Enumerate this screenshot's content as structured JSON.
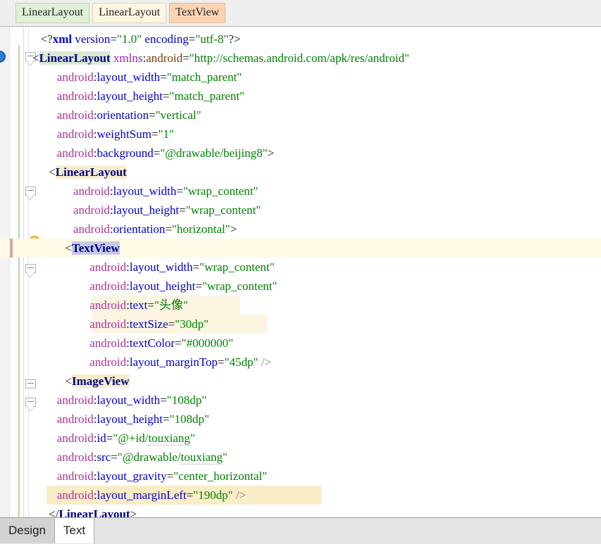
{
  "window": {
    "editor_type": "android-xml-layout-editor"
  },
  "breadcrumb": {
    "name": "component-breadcrumb",
    "chips": [
      {
        "label": "LinearLayout",
        "color": "#dff0d8",
        "state": "root"
      },
      {
        "label": "LinearLayout",
        "color": "#fdf6e0",
        "state": "parent"
      },
      {
        "label": "TextView",
        "color": "#fbd3b4",
        "state": "selected"
      }
    ]
  },
  "gutter": {
    "icons": [
      {
        "name": "breakpoint-circle-icon",
        "type": "circle",
        "color": "#2d7fd6"
      },
      {
        "name": "intention-lightbulb-icon",
        "type": "lightbulb",
        "color": "#f5b428"
      }
    ],
    "fold_markers": [
      "collapse-1",
      "collapse-2",
      "collapse-3",
      "collapse-4"
    ]
  },
  "colors": {
    "tag": "#000080",
    "attribute": "#0000cc",
    "namespace": "#9c27b0",
    "string": "#008000",
    "punctuation": "#222222",
    "current_line_bg": "#fffae6",
    "cream_highlight_bg": "#fbf5e2",
    "tan_highlight_bg": "#f9edc8",
    "selection_bg": "#c5cbe8",
    "tag_match_bg": "#d9ead3"
  },
  "code": {
    "file_type": "xml",
    "lines": [
      {
        "id": "line-1",
        "indent": 1,
        "row_highlight": "none",
        "tokens": [
          {
            "t": "<?",
            "c": "punct"
          },
          {
            "t": "xml",
            "c": "xmlkw"
          },
          {
            "t": " ",
            "c": "punct"
          },
          {
            "t": "version",
            "c": "decl"
          },
          {
            "t": "=",
            "c": "punct"
          },
          {
            "t": "\"1.0\"",
            "c": "string"
          },
          {
            "t": " ",
            "c": "punct"
          },
          {
            "t": "encoding",
            "c": "decl"
          },
          {
            "t": "=",
            "c": "punct"
          },
          {
            "t": "\"utf-8\"",
            "c": "string"
          },
          {
            "t": "?>",
            "c": "punct"
          }
        ]
      },
      {
        "id": "line-2",
        "indent": 0,
        "row_highlight": "none",
        "tokens": [
          {
            "t": "<",
            "c": "punct"
          },
          {
            "t": "LinearLayout",
            "c": "tag",
            "bg": "tagmatch"
          },
          {
            "t": " ",
            "c": "punct"
          },
          {
            "t": "xmlns",
            "c": "ns"
          },
          {
            "t": ":",
            "c": "punct"
          },
          {
            "t": "android",
            "c": "ns-dark"
          },
          {
            "t": "=",
            "c": "punct"
          },
          {
            "t": "\"http://schemas.android.com/apk/res/android\"",
            "c": "string"
          }
        ]
      },
      {
        "id": "line-3",
        "indent": 3,
        "row_highlight": "none",
        "tokens": [
          {
            "t": "android",
            "c": "prefix"
          },
          {
            "t": ":",
            "c": "punct"
          },
          {
            "t": "layout_width",
            "c": "attr"
          },
          {
            "t": "=",
            "c": "punct"
          },
          {
            "t": "\"match_parent\"",
            "c": "string"
          }
        ]
      },
      {
        "id": "line-4",
        "indent": 3,
        "row_highlight": "none",
        "tokens": [
          {
            "t": "android",
            "c": "prefix"
          },
          {
            "t": ":",
            "c": "punct"
          },
          {
            "t": "layout_height",
            "c": "attr"
          },
          {
            "t": "=",
            "c": "punct"
          },
          {
            "t": "\"match_parent\"",
            "c": "string"
          }
        ]
      },
      {
        "id": "line-5",
        "indent": 3,
        "row_highlight": "none",
        "tokens": [
          {
            "t": "android",
            "c": "prefix"
          },
          {
            "t": ":",
            "c": "punct"
          },
          {
            "t": "orientation",
            "c": "attr"
          },
          {
            "t": "=",
            "c": "punct"
          },
          {
            "t": "\"vertical\"",
            "c": "string"
          }
        ]
      },
      {
        "id": "line-6",
        "indent": 3,
        "row_highlight": "none",
        "tokens": [
          {
            "t": "android",
            "c": "prefix"
          },
          {
            "t": ":",
            "c": "punct"
          },
          {
            "t": "weightSum",
            "c": "attr"
          },
          {
            "t": "=",
            "c": "punct"
          },
          {
            "t": "\"1\"",
            "c": "string"
          }
        ]
      },
      {
        "id": "line-7",
        "indent": 3,
        "row_highlight": "none",
        "tokens": [
          {
            "t": "android",
            "c": "prefix"
          },
          {
            "t": ":",
            "c": "punct"
          },
          {
            "t": "background",
            "c": "attr"
          },
          {
            "t": "=",
            "c": "punct"
          },
          {
            "t": "\"@drawable/beijing8\"",
            "c": "string"
          },
          {
            "t": ">",
            "c": "punct"
          }
        ]
      },
      {
        "id": "line-8",
        "indent": 2,
        "row_highlight": "none",
        "tokens": [
          {
            "t": "<",
            "c": "punct"
          },
          {
            "t": "LinearLayout",
            "c": "tag",
            "bg": "token"
          }
        ]
      },
      {
        "id": "line-9",
        "indent": 5,
        "row_highlight": "none",
        "tokens": [
          {
            "t": "android",
            "c": "prefix"
          },
          {
            "t": ":",
            "c": "punct"
          },
          {
            "t": "layout_width",
            "c": "attr"
          },
          {
            "t": "=",
            "c": "punct"
          },
          {
            "t": "\"wrap_content\"",
            "c": "string"
          }
        ]
      },
      {
        "id": "line-10",
        "indent": 5,
        "row_highlight": "none",
        "tokens": [
          {
            "t": "android",
            "c": "prefix"
          },
          {
            "t": ":",
            "c": "punct"
          },
          {
            "t": "layout_height",
            "c": "attr"
          },
          {
            "t": "=",
            "c": "punct"
          },
          {
            "t": "\"wrap_content\"",
            "c": "string"
          }
        ]
      },
      {
        "id": "line-11",
        "indent": 5,
        "row_highlight": "none",
        "tokens": [
          {
            "t": "android",
            "c": "prefix"
          },
          {
            "t": ":",
            "c": "punct"
          },
          {
            "t": "orientation",
            "c": "attr"
          },
          {
            "t": "=",
            "c": "punct"
          },
          {
            "t": "\"horizontal\"",
            "c": "string"
          },
          {
            "t": ">",
            "c": "punct"
          }
        ]
      },
      {
        "id": "line-12",
        "indent": 4,
        "row_highlight": "current",
        "change_bar": true,
        "tokens": [
          {
            "t": "<",
            "c": "punct"
          },
          {
            "t": "TextView",
            "c": "tag",
            "bg": "sel"
          }
        ]
      },
      {
        "id": "line-13",
        "indent": 7,
        "row_highlight": "none",
        "tokens": [
          {
            "t": "android",
            "c": "prefix"
          },
          {
            "t": ":",
            "c": "punct"
          },
          {
            "t": "layout_width",
            "c": "attr"
          },
          {
            "t": "=",
            "c": "punct"
          },
          {
            "t": "\"wrap_content\"",
            "c": "string"
          }
        ]
      },
      {
        "id": "line-14",
        "indent": 7,
        "row_highlight": "none",
        "tokens": [
          {
            "t": "android",
            "c": "prefix"
          },
          {
            "t": ":",
            "c": "punct"
          },
          {
            "t": "layout_height",
            "c": "attr"
          },
          {
            "t": "=",
            "c": "punct"
          },
          {
            "t": "\"wrap_content\"",
            "c": "string"
          }
        ]
      },
      {
        "id": "line-15",
        "indent": 7,
        "row_highlight": "cream",
        "hl_start": 130,
        "hl_width": 210,
        "tokens": [
          {
            "t": "android",
            "c": "prefix"
          },
          {
            "t": ":",
            "c": "punct"
          },
          {
            "t": "text",
            "c": "attr"
          },
          {
            "t": "=",
            "c": "punct"
          },
          {
            "t": "\"头像\"",
            "c": "string"
          }
        ]
      },
      {
        "id": "line-16",
        "indent": 7,
        "row_highlight": "cream",
        "hl_start": 130,
        "hl_width": 250,
        "tokens": [
          {
            "t": "android",
            "c": "prefix"
          },
          {
            "t": ":",
            "c": "punct"
          },
          {
            "t": "textSize",
            "c": "attr"
          },
          {
            "t": "=",
            "c": "punct"
          },
          {
            "t": "\"30dp\"",
            "c": "string"
          }
        ]
      },
      {
        "id": "line-17",
        "indent": 7,
        "row_highlight": "none",
        "tokens": [
          {
            "t": "android",
            "c": "prefix"
          },
          {
            "t": ":",
            "c": "punct"
          },
          {
            "t": "textColor",
            "c": "attr"
          },
          {
            "t": "=",
            "c": "punct"
          },
          {
            "t": "\"#000000\"",
            "c": "string"
          }
        ]
      },
      {
        "id": "line-18",
        "indent": 7,
        "row_highlight": "none",
        "tokens": [
          {
            "t": "android",
            "c": "prefix"
          },
          {
            "t": ":",
            "c": "punct"
          },
          {
            "t": "layout_marginTop",
            "c": "attr"
          },
          {
            "t": "=",
            "c": "punct"
          },
          {
            "t": "\"45dp\"",
            "c": "string"
          },
          {
            "t": " ",
            "c": "punct"
          },
          {
            "t": "/>",
            "c": "gray"
          }
        ]
      },
      {
        "id": "line-19",
        "indent": 4,
        "row_highlight": "none",
        "tokens": [
          {
            "t": "<",
            "c": "punct"
          },
          {
            "t": "ImageView",
            "c": "tag",
            "bg": "token"
          }
        ]
      },
      {
        "id": "line-20",
        "indent": 3,
        "row_highlight": "none",
        "tokens": [
          {
            "t": "android",
            "c": "prefix"
          },
          {
            "t": ":",
            "c": "punct"
          },
          {
            "t": "layout_width",
            "c": "attr"
          },
          {
            "t": "=",
            "c": "punct"
          },
          {
            "t": "\"108dp\"",
            "c": "string"
          }
        ]
      },
      {
        "id": "line-21",
        "indent": 3,
        "row_highlight": "none",
        "tokens": [
          {
            "t": "android",
            "c": "prefix"
          },
          {
            "t": ":",
            "c": "punct"
          },
          {
            "t": "layout_height",
            "c": "attr"
          },
          {
            "t": "=",
            "c": "punct"
          },
          {
            "t": "\"108dp\"",
            "c": "string"
          }
        ]
      },
      {
        "id": "line-22",
        "indent": 3,
        "row_highlight": "none",
        "tokens": [
          {
            "t": "android",
            "c": "prefix"
          },
          {
            "t": ":",
            "c": "punct"
          },
          {
            "t": "id",
            "c": "attr"
          },
          {
            "t": "=",
            "c": "punct"
          },
          {
            "t": "\"@+id/",
            "c": "string"
          },
          {
            "t": "touxiang",
            "c": "unres"
          },
          {
            "t": "\"",
            "c": "string"
          }
        ]
      },
      {
        "id": "line-23",
        "indent": 3,
        "row_highlight": "none",
        "tokens": [
          {
            "t": "android",
            "c": "prefix"
          },
          {
            "t": ":",
            "c": "punct"
          },
          {
            "t": "src",
            "c": "attr"
          },
          {
            "t": "=",
            "c": "punct"
          },
          {
            "t": "\"@drawable/",
            "c": "string"
          },
          {
            "t": "touxiang",
            "c": "unres"
          },
          {
            "t": "\"",
            "c": "string"
          }
        ]
      },
      {
        "id": "line-24",
        "indent": 3,
        "row_highlight": "none",
        "tokens": [
          {
            "t": "android",
            "c": "prefix"
          },
          {
            "t": ":",
            "c": "punct"
          },
          {
            "t": "layout_gravity",
            "c": "attr"
          },
          {
            "t": "=",
            "c": "punct"
          },
          {
            "t": "\"center_horizontal\"",
            "c": "string"
          }
        ]
      },
      {
        "id": "line-25",
        "indent": 3,
        "row_highlight": "tan",
        "hl_start": 66,
        "hl_width": 390,
        "tokens": [
          {
            "t": "android",
            "c": "prefix"
          },
          {
            "t": ":",
            "c": "punct"
          },
          {
            "t": "layout_marginLeft",
            "c": "attr"
          },
          {
            "t": "=",
            "c": "punct"
          },
          {
            "t": "\"190dp\"",
            "c": "string"
          },
          {
            "t": " ",
            "c": "punct"
          },
          {
            "t": "/>",
            "c": "gray"
          }
        ]
      },
      {
        "id": "line-26",
        "indent": 2,
        "row_highlight": "none",
        "tokens": [
          {
            "t": "</",
            "c": "punct"
          },
          {
            "t": "LinearLayout",
            "c": "tag"
          },
          {
            "t": ">",
            "c": "punct"
          }
        ]
      }
    ]
  },
  "bottom_tabs": {
    "name": "editor-mode-tabs",
    "tabs": [
      {
        "label": "Design",
        "active": false
      },
      {
        "label": "Text",
        "active": true
      }
    ]
  }
}
